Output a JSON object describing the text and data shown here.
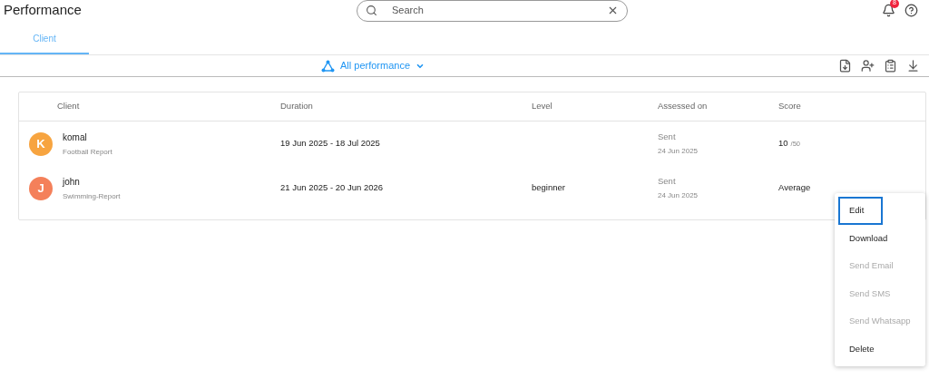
{
  "header": {
    "title": "Performance",
    "search": {
      "placeholder": "Search"
    },
    "notifications": {
      "count": "8"
    }
  },
  "tabs": [
    {
      "label": "Client",
      "selected": true
    }
  ],
  "toolbar": {
    "filter": "All performance"
  },
  "table": {
    "columns": [
      "Client",
      "Duration",
      "Level",
      "Assessed on",
      "Score"
    ],
    "rows": [
      {
        "initial": "K",
        "color": "#f7a440",
        "name": "komal",
        "report": "Football Report",
        "duration": "19 Jun 2025 - 18 Jul 2025",
        "status": "Sent",
        "date": "24 Jun 2025",
        "score": "10",
        "score_max": "/50"
      },
      {
        "initial": "J",
        "color": "#f4805a",
        "name": "john",
        "report": "Swimming-Report",
        "duration": "21 Jun 2025 - 20 Jun 2026",
        "level": "beginner",
        "status": "Sent",
        "date": "24 Jun 2025",
        "score": "Average"
      }
    ]
  },
  "menu": [
    {
      "label": "Edit",
      "selected": true,
      "disabled": false
    },
    {
      "label": "Download",
      "selected": false,
      "disabled": false
    },
    {
      "label": "Send Email",
      "selected": false,
      "disabled": true
    },
    {
      "label": "Send SMS",
      "selected": false,
      "disabled": true
    },
    {
      "label": "Send Whatsapp",
      "selected": false,
      "disabled": true
    },
    {
      "label": "Delete",
      "selected": false,
      "disabled": false
    }
  ]
}
